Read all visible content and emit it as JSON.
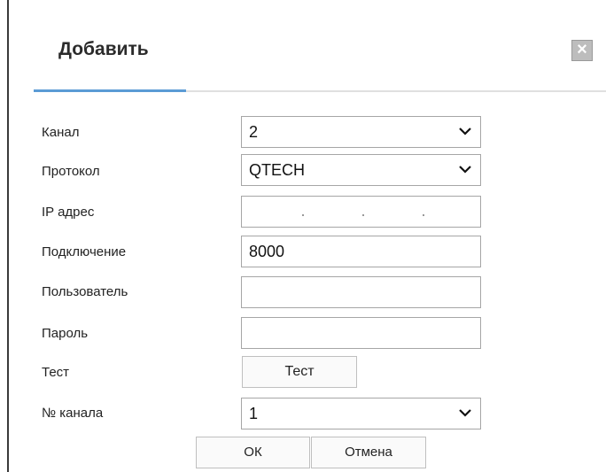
{
  "dialog": {
    "title": "Добавить",
    "close_icon": "close-icon"
  },
  "form": {
    "channel": {
      "label": "Канал",
      "value": "2"
    },
    "protocol": {
      "label": "Протокол",
      "value": "QTECH"
    },
    "ip": {
      "label": "IP адрес",
      "value": ""
    },
    "port": {
      "label": "Подключение",
      "value": "8000"
    },
    "user": {
      "label": "Пользователь",
      "value": ""
    },
    "password": {
      "label": "Пароль",
      "value": ""
    },
    "test": {
      "label": "Тест",
      "button_label": "Тест"
    },
    "channel_no": {
      "label": "№ канала",
      "value": "1"
    }
  },
  "buttons": {
    "ok": "ОК",
    "cancel": "Отмена"
  },
  "colors": {
    "accent": "#5b9bd5",
    "border": "#a6a6a6"
  }
}
